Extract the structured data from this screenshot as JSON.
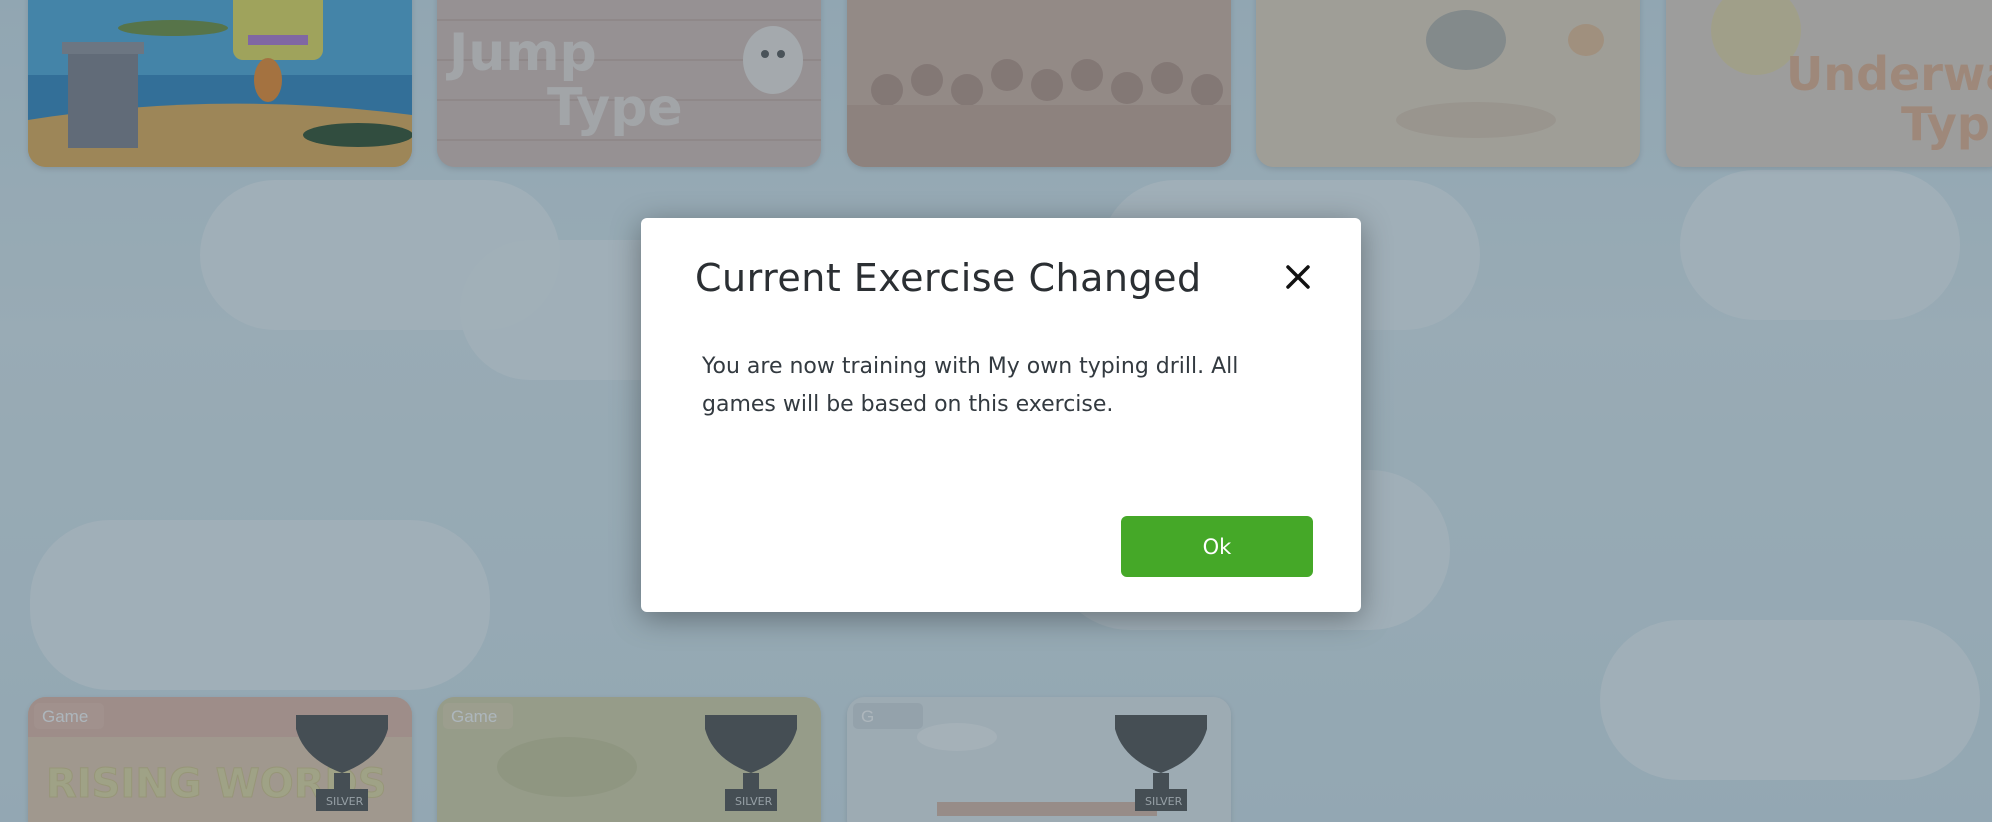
{
  "modal": {
    "title": "Current Exercise Changed",
    "body": "You are now training with My own typing drill. All games will be based on this exercise.",
    "ok_label": "Ok",
    "close_icon": "close-icon"
  },
  "games_top": [
    {
      "title": ""
    },
    {
      "title": "Jump Type"
    },
    {
      "title": ""
    },
    {
      "title": ""
    },
    {
      "title": "Underwater Typing"
    }
  ],
  "games_bottom": [
    {
      "badge": "Game",
      "title": "RISING WORDS",
      "trophy": "SILVER"
    },
    {
      "badge": "Game",
      "title": "",
      "trophy": "SILVER"
    },
    {
      "badge": "G",
      "title": "",
      "trophy": "SILVER"
    }
  ],
  "colors": {
    "ok_button": "#45a828",
    "overlay": "rgba(60,80,95,0.42)"
  }
}
